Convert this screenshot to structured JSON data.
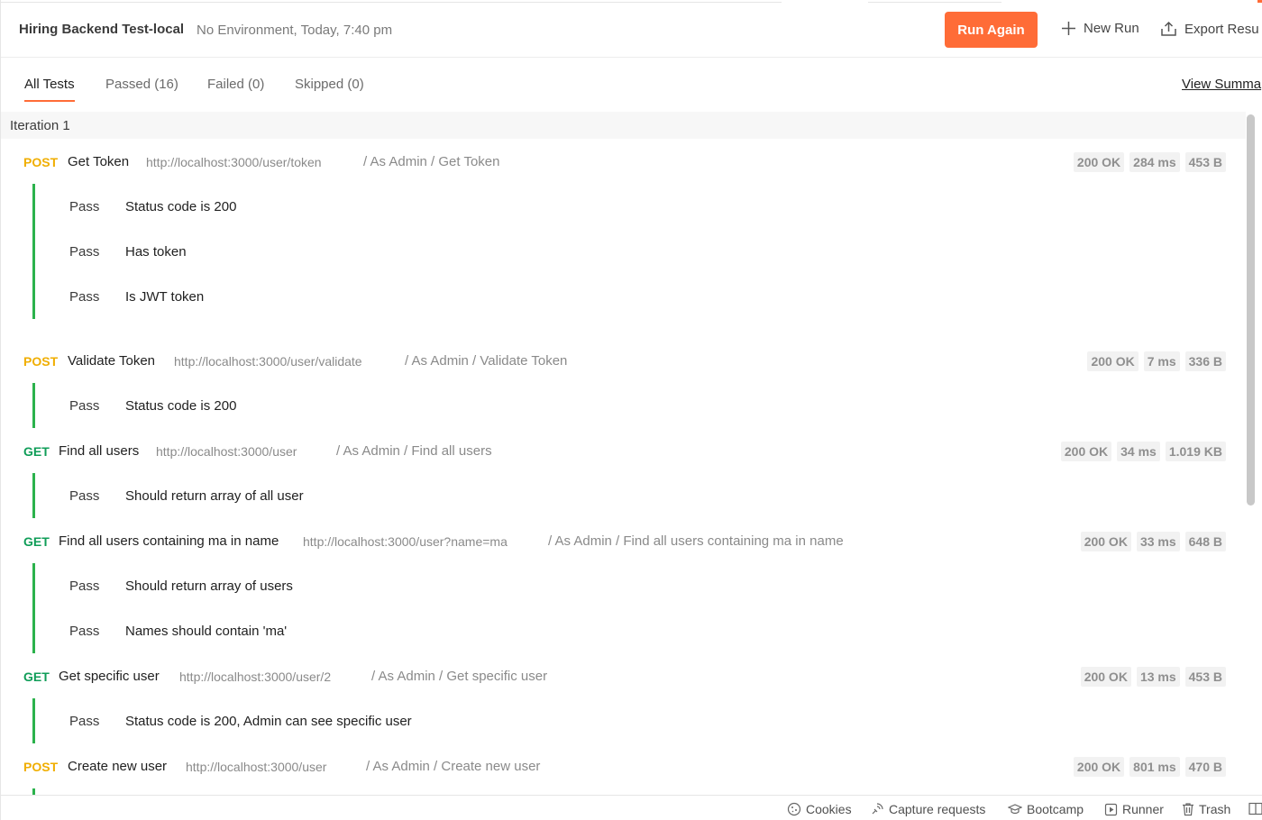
{
  "header": {
    "run_name": "Hiring Backend Test-local",
    "run_meta": "No Environment, Today, 7:40 pm",
    "run_again_label": "Run Again",
    "new_run_label": "New Run",
    "export_label": "Export Resu"
  },
  "tabs": {
    "all": "All Tests",
    "passed": "Passed (16)",
    "failed": "Failed (0)",
    "skipped": "Skipped (0)",
    "view_summary": "View Summa"
  },
  "iteration": "Iteration 1",
  "requests": [
    {
      "method": "POST",
      "name": "Get Token",
      "url": "http://localhost:3000/user/token",
      "path": "/ As Admin / Get Token",
      "status": "200 OK",
      "time": "284 ms",
      "size": "453 B",
      "tests": [
        {
          "result": "Pass",
          "name": "Status code is 200"
        },
        {
          "result": "Pass",
          "name": "Has token"
        },
        {
          "result": "Pass",
          "name": "Is JWT token"
        }
      ]
    },
    {
      "method": "POST",
      "name": "Validate Token",
      "url": "http://localhost:3000/user/validate",
      "path": "/ As Admin / Validate Token",
      "status": "200 OK",
      "time": "7 ms",
      "size": "336 B",
      "tests": [
        {
          "result": "Pass",
          "name": "Status code is 200"
        }
      ]
    },
    {
      "method": "GET",
      "name": "Find all users",
      "url": "http://localhost:3000/user",
      "path": "/ As Admin / Find all users",
      "status": "200 OK",
      "time": "34 ms",
      "size": "1.019 KB",
      "tests": [
        {
          "result": "Pass",
          "name": "Should return array of all user"
        }
      ]
    },
    {
      "method": "GET",
      "name": "Find all users containing ma in name",
      "url": "http://localhost:3000/user?name=ma",
      "path": "/ As Admin / Find all users containing ma in name",
      "status": "200 OK",
      "time": "33 ms",
      "size": "648 B",
      "tests": [
        {
          "result": "Pass",
          "name": "Should return array of users"
        },
        {
          "result": "Pass",
          "name": "Names should contain 'ma'"
        }
      ]
    },
    {
      "method": "GET",
      "name": "Get specific user",
      "url": "http://localhost:3000/user/2",
      "path": "/ As Admin / Get specific user",
      "status": "200 OK",
      "time": "13 ms",
      "size": "453 B",
      "tests": [
        {
          "result": "Pass",
          "name": "Status code is 200, Admin can see specific user"
        }
      ]
    },
    {
      "method": "POST",
      "name": "Create new user",
      "url": "http://localhost:3000/user",
      "path": "/ As Admin / Create new user",
      "status": "200 OK",
      "time": "801 ms",
      "size": "470 B",
      "tests": []
    }
  ],
  "footer": {
    "cookies": "Cookies",
    "capture": "Capture requests",
    "bootcamp": "Bootcamp",
    "runner": "Runner",
    "trash": "Trash"
  },
  "colors": {
    "accent": "#ff6c37",
    "post": "#f0ae00",
    "get": "#0f9d58",
    "pass_bar": "#2bb24c"
  }
}
